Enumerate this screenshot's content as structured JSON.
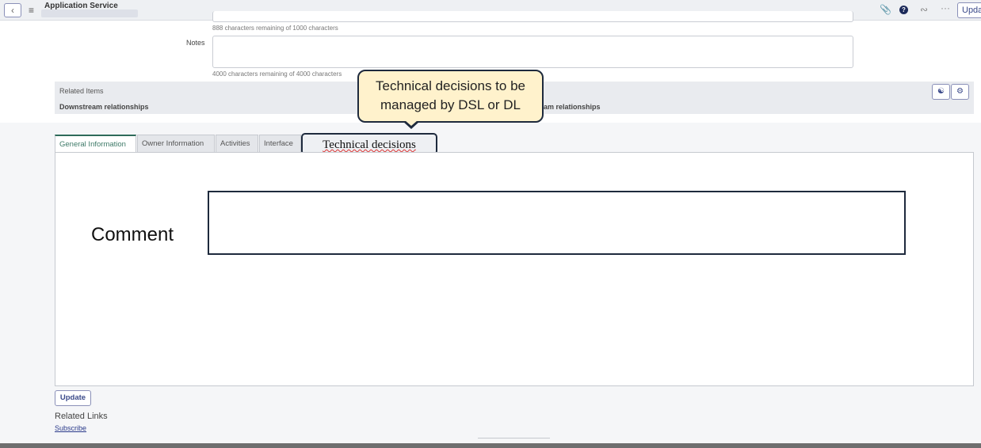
{
  "header": {
    "title": "Application Service",
    "update_label": "Upda",
    "icons": [
      "back-icon",
      "menu-icon",
      "paperclip-icon",
      "help-icon",
      "activity-icon",
      "more-icon"
    ]
  },
  "form": {
    "prev_hint": "888 characters remaining of 1000 characters",
    "notes_label": "Notes",
    "notes_hint": "4000 characters remaining of 4000 characters"
  },
  "related": {
    "title": "Related Items",
    "downstream": "Downstream relationships",
    "upstream": "am relationships"
  },
  "callout": {
    "text": "Technical decisions to be managed by DSL or DL"
  },
  "tabs": [
    {
      "label": "General Information",
      "active": true
    },
    {
      "label": "Owner Information"
    },
    {
      "label": "Activities"
    },
    {
      "label": "Interface"
    },
    {
      "label": "Technical decisions"
    }
  ],
  "panel": {
    "comment_label": "Comment",
    "comment_value": ""
  },
  "footer": {
    "update_label": "Update",
    "related_links": "Related Links",
    "subscribe": "Subscribe"
  }
}
